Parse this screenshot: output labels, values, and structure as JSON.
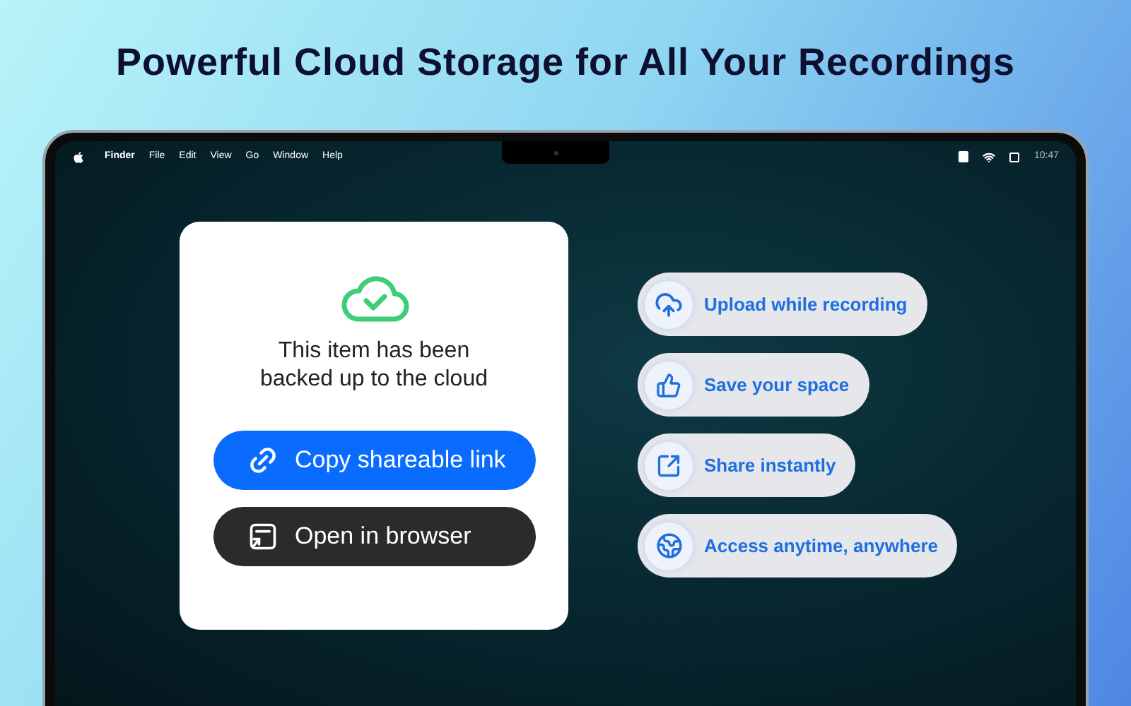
{
  "headline": "Powerful Cloud Storage for All Your Recordings",
  "menu_bar": {
    "app_name": "Finder",
    "items": [
      "File",
      "Edit",
      "View",
      "Go",
      "Window",
      "Help"
    ],
    "time": "10:47"
  },
  "card": {
    "message": "This item has been backed up to the cloud",
    "buttons": [
      {
        "label": "Copy shareable link",
        "kind": "primary"
      },
      {
        "label": "Open in browser",
        "kind": "dark"
      }
    ]
  },
  "features": [
    {
      "label": "Upload while recording"
    },
    {
      "label": "Save your space"
    },
    {
      "label": "Share instantly"
    },
    {
      "label": "Access anytime, anywhere"
    }
  ]
}
